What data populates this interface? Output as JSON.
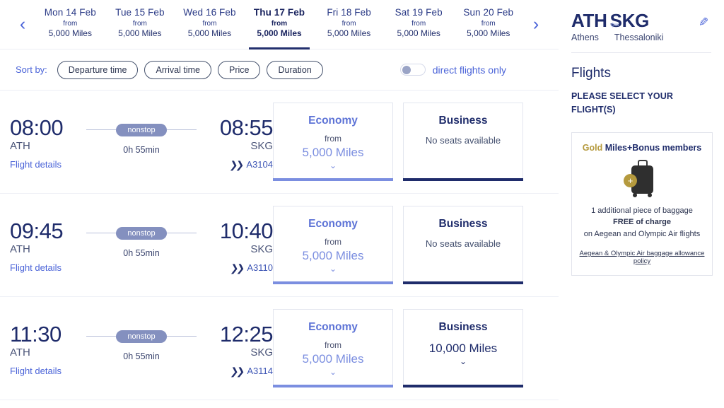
{
  "datestrip": {
    "prev_icon": "chevron-left-icon",
    "next_icon": "chevron-right-icon",
    "prev_label": "‹",
    "next_label": "›",
    "dates": [
      {
        "day": "Mon 14 Feb",
        "from": "from",
        "price": "5,000 Miles",
        "active": false
      },
      {
        "day": "Tue 15 Feb",
        "from": "from",
        "price": "5,000 Miles",
        "active": false
      },
      {
        "day": "Wed 16 Feb",
        "from": "from",
        "price": "5,000 Miles",
        "active": false
      },
      {
        "day": "Thu 17 Feb",
        "from": "from",
        "price": "5,000 Miles",
        "active": true
      },
      {
        "day": "Fri 18 Feb",
        "from": "from",
        "price": "5,000 Miles",
        "active": false
      },
      {
        "day": "Sat 19 Feb",
        "from": "from",
        "price": "5,000 Miles",
        "active": false
      },
      {
        "day": "Sun 20 Feb",
        "from": "from",
        "price": "5,000 Miles",
        "active": false
      }
    ]
  },
  "sortbar": {
    "label": "Sort by:",
    "options": [
      "Departure time",
      "Arrival time",
      "Price",
      "Duration"
    ],
    "toggle_label": "direct flights only",
    "toggle_on": false
  },
  "flights": [
    {
      "depart_time": "08:00",
      "depart_code": "ATH",
      "details_label": "Flight details",
      "stops": "nonstop",
      "duration": "0h 55min",
      "arrive_time": "08:55",
      "arrive_code": "SKG",
      "flight_number": "A3104",
      "economy": {
        "title": "Economy",
        "from": "from",
        "price": "5,000 Miles",
        "available": true
      },
      "business": {
        "title": "Business",
        "unavailable": "No seats available",
        "available": false
      }
    },
    {
      "depart_time": "09:45",
      "depart_code": "ATH",
      "details_label": "Flight details",
      "stops": "nonstop",
      "duration": "0h 55min",
      "arrive_time": "10:40",
      "arrive_code": "SKG",
      "flight_number": "A3110",
      "economy": {
        "title": "Economy",
        "from": "from",
        "price": "5,000 Miles",
        "available": true
      },
      "business": {
        "title": "Business",
        "unavailable": "No seats available",
        "available": false
      }
    },
    {
      "depart_time": "11:30",
      "depart_code": "ATH",
      "details_label": "Flight details",
      "stops": "nonstop",
      "duration": "0h 55min",
      "arrive_time": "12:25",
      "arrive_code": "SKG",
      "flight_number": "A3114",
      "economy": {
        "title": "Economy",
        "from": "from",
        "price": "5,000 Miles",
        "available": true
      },
      "business": {
        "title": "Business",
        "from": "",
        "price": "10,000 Miles",
        "available": true
      }
    }
  ],
  "sidebar": {
    "origin_code": "ATH",
    "destination_code": "SKG",
    "origin_city": "Athens",
    "destination_city": "Thessaloniki",
    "swap_icon": "arrow-left-icon",
    "swap_glyph": "⇦",
    "edit_icon": "pencil-icon",
    "edit_glyph": "✎",
    "flights_heading": "Flights",
    "select_note": "PLEASE SELECT YOUR FLIGHT(S)",
    "promo": {
      "tier": "Gold",
      "title_rest": " Miles+Bonus members",
      "bag_icon": "suitcase-icon",
      "plus_icon": "plus-badge-icon",
      "line1": "1 additional piece of baggage",
      "line2": "FREE of charge",
      "line3": "on Aegean and Olympic Air flights",
      "link": "Aegean & Olympic Air baggage allowance policy"
    }
  },
  "colors": {
    "navy": "#1f2c6b",
    "royal_blue": "#4a63d8",
    "periwinkle": "#7b8ee0",
    "stop_badge": "#8490bf",
    "gold": "#b59a3e"
  }
}
